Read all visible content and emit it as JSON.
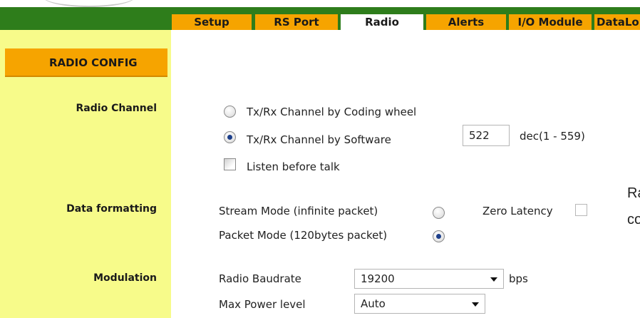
{
  "tabs": [
    {
      "label": "Setup"
    },
    {
      "label": "RS Port"
    },
    {
      "label": "Radio"
    },
    {
      "label": "Alerts"
    },
    {
      "label": "I/O Module"
    },
    {
      "label": "DataLo"
    }
  ],
  "section_title": "RADIO CONFIG",
  "radio_channel": {
    "label": "Radio Channel",
    "option_wheel": "Tx/Rx Channel by Coding wheel",
    "option_software": "Tx/Rx Channel by Software",
    "selected": "software",
    "channel_value": "522",
    "range_text": "dec(1 - 559)",
    "listen_label": "Listen before talk",
    "listen_checked": false
  },
  "data_formatting": {
    "label": "Data formatting",
    "stream_label": "Stream Mode (infinite packet)",
    "packet_label": "Packet Mode (120bytes packet)",
    "selected": "packet",
    "zero_latency_label": "Zero Latency",
    "zero_latency_checked": false
  },
  "modulation": {
    "label": "Modulation",
    "baud_label": "Radio Baudrate",
    "baud_value": "19200",
    "baud_unit": "bps",
    "power_label": "Max Power level",
    "power_value": "Auto"
  },
  "side_note": {
    "line1": "Ra",
    "line2": "co"
  }
}
